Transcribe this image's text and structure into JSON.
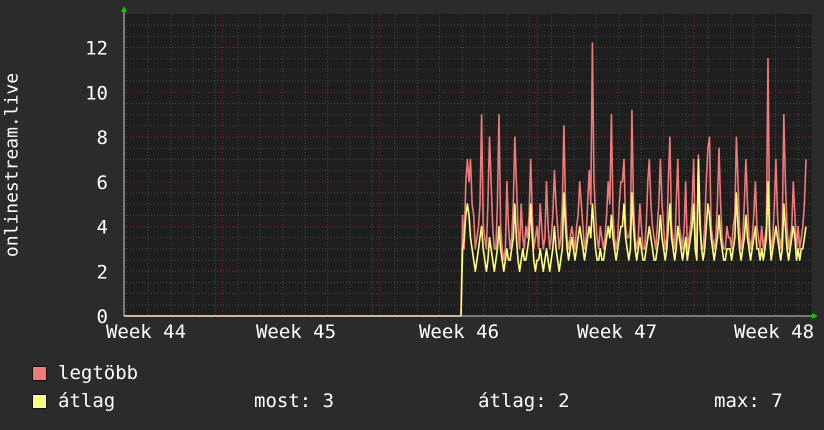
{
  "chart_data": {
    "type": "line",
    "ylabel": "onlinestream.live",
    "ylim": [
      0,
      13.5
    ],
    "yticks": [
      0,
      2,
      4,
      6,
      8,
      10,
      12
    ],
    "x_tick_labels": [
      "Week 44",
      "Week 45",
      "Week 46",
      "Week 47",
      "Week 48"
    ],
    "grid": true,
    "background": "#1e1e1e",
    "grid_color": "#a02020",
    "series": [
      {
        "name": "legtöbb",
        "color": "#f07b7b",
        "values": [
          0,
          0,
          0,
          0,
          0,
          0,
          0,
          0,
          0,
          0,
          0,
          0,
          0,
          0,
          0,
          0,
          0,
          0,
          0,
          0,
          0,
          0,
          0,
          0,
          0,
          0,
          0,
          0,
          0,
          0,
          0,
          0,
          0,
          0,
          0,
          0,
          0,
          0,
          0,
          0,
          0,
          0,
          0,
          0,
          0,
          0,
          0,
          0,
          0,
          0,
          0,
          0,
          0,
          0,
          0,
          0,
          0,
          0,
          0,
          0,
          0,
          0,
          0,
          0,
          0,
          0,
          0,
          0,
          0,
          0,
          0,
          0,
          0,
          0,
          0,
          0,
          0,
          0,
          0,
          0,
          0,
          0,
          0,
          0,
          0,
          0,
          0,
          0,
          0,
          0,
          0,
          0,
          0,
          0,
          0,
          0,
          0,
          0,
          0,
          0,
          0,
          0,
          0,
          0,
          0,
          0,
          0,
          0,
          0,
          0,
          0,
          0,
          0,
          0,
          0,
          0,
          0,
          0,
          0,
          0,
          0,
          0,
          0,
          0,
          0,
          0,
          0,
          0,
          0,
          0,
          0,
          0,
          0,
          0,
          0,
          0,
          0,
          0,
          0,
          0,
          0,
          0,
          0,
          0,
          0,
          0,
          0,
          0,
          0,
          0,
          0,
          0,
          0,
          0,
          0,
          0,
          0,
          0,
          0,
          0,
          0,
          0,
          0,
          0,
          0,
          0,
          0,
          0,
          0,
          0,
          0,
          0,
          0,
          0,
          0,
          0,
          0,
          0,
          0,
          0,
          0,
          0,
          0,
          0,
          0,
          0,
          0,
          0,
          0,
          0,
          0,
          0,
          0,
          0,
          0,
          0,
          0,
          0,
          0,
          0,
          0,
          0,
          0,
          0,
          0,
          0,
          0,
          0,
          0,
          0,
          0,
          0,
          0,
          0,
          4.5,
          3,
          6,
          7,
          6,
          7,
          5,
          4.5,
          3,
          3.5,
          4,
          5,
          9,
          4,
          3.5,
          3,
          5,
          8,
          6,
          4,
          3,
          3,
          5,
          9,
          4,
          3,
          2.5,
          3,
          6,
          4,
          3,
          3.5,
          5,
          8,
          6,
          4,
          3,
          5,
          3.5,
          3,
          4,
          3.5,
          4.5,
          7,
          4.5,
          3,
          3.5,
          4,
          3,
          5,
          4,
          3,
          3.5,
          6,
          4,
          3,
          3.5,
          4.5,
          6.5,
          5,
          4,
          3,
          3.5,
          5,
          8.5,
          5,
          3.5,
          3,
          3.5,
          4,
          3.5,
          3,
          4,
          4.5,
          6,
          5,
          4,
          3,
          3.5,
          5,
          6.5,
          5,
          12.2,
          6,
          4.5,
          3.5,
          3,
          4,
          3.5,
          3,
          3.5,
          4.5,
          6,
          5,
          9,
          4.5,
          3.5,
          3,
          3.5,
          5,
          6,
          6,
          7,
          4,
          3.5,
          3.5,
          4,
          9.2,
          5,
          3.5,
          3,
          3.5,
          5,
          4,
          3,
          3,
          4,
          6,
          7,
          5,
          4,
          3.5,
          3,
          4,
          5,
          7,
          5,
          4,
          3,
          3.5,
          6,
          8,
          4,
          3.5,
          3,
          5,
          7,
          4,
          3.5,
          3,
          4,
          6,
          3,
          3.5,
          4,
          5,
          7,
          3.5,
          3,
          7.2,
          4.5,
          3,
          3,
          4,
          6,
          7.5,
          8,
          4,
          3.5,
          3,
          3.5,
          5,
          7.5,
          5,
          3.5,
          3,
          3,
          4,
          3.5,
          3.5,
          3,
          4,
          4.5,
          8,
          6,
          4,
          3,
          3.5,
          5,
          7,
          5,
          3.5,
          3,
          3.5,
          4.5,
          6,
          4,
          3.5,
          3,
          4,
          3,
          3.5,
          4,
          11.5,
          4,
          3,
          3.5,
          5,
          7,
          4.5,
          3.5,
          3,
          4,
          9,
          6,
          4,
          3,
          3.5,
          4,
          6,
          4.5,
          3,
          4,
          3,
          3.5,
          4,
          5,
          7
        ]
      },
      {
        "name": "átlag",
        "color": "#ffff80",
        "values": [
          0,
          0,
          0,
          0,
          0,
          0,
          0,
          0,
          0,
          0,
          0,
          0,
          0,
          0,
          0,
          0,
          0,
          0,
          0,
          0,
          0,
          0,
          0,
          0,
          0,
          0,
          0,
          0,
          0,
          0,
          0,
          0,
          0,
          0,
          0,
          0,
          0,
          0,
          0,
          0,
          0,
          0,
          0,
          0,
          0,
          0,
          0,
          0,
          0,
          0,
          0,
          0,
          0,
          0,
          0,
          0,
          0,
          0,
          0,
          0,
          0,
          0,
          0,
          0,
          0,
          0,
          0,
          0,
          0,
          0,
          0,
          0,
          0,
          0,
          0,
          0,
          0,
          0,
          0,
          0,
          0,
          0,
          0,
          0,
          0,
          0,
          0,
          0,
          0,
          0,
          0,
          0,
          0,
          0,
          0,
          0,
          0,
          0,
          0,
          0,
          0,
          0,
          0,
          0,
          0,
          0,
          0,
          0,
          0,
          0,
          0,
          0,
          0,
          0,
          0,
          0,
          0,
          0,
          0,
          0,
          0,
          0,
          0,
          0,
          0,
          0,
          0,
          0,
          0,
          0,
          0,
          0,
          0,
          0,
          0,
          0,
          0,
          0,
          0,
          0,
          0,
          0,
          0,
          0,
          0,
          0,
          0,
          0,
          0,
          0,
          0,
          0,
          0,
          0,
          0,
          0,
          0,
          0,
          0,
          0,
          0,
          0,
          0,
          0,
          0,
          0,
          0,
          0,
          0,
          0,
          0,
          0,
          0,
          0,
          0,
          0,
          0,
          0,
          0,
          0,
          0,
          0,
          0,
          0,
          0,
          0,
          0,
          0,
          0,
          0,
          0,
          0,
          0,
          0,
          0,
          0,
          0,
          0,
          0,
          0,
          0,
          0,
          0,
          0,
          0,
          0,
          0,
          0,
          0,
          0,
          0,
          0,
          0,
          0,
          3,
          3.5,
          4.5,
          5,
          4.5,
          3.5,
          3,
          2.5,
          2,
          2.5,
          3,
          3.5,
          4,
          3,
          2.5,
          2,
          2.5,
          3.5,
          3,
          2.5,
          2,
          2.5,
          3,
          4,
          3,
          2.5,
          2,
          2.5,
          3,
          2.5,
          2.5,
          3,
          3.5,
          5,
          3.5,
          2.5,
          2,
          2.5,
          3,
          2.5,
          2.5,
          3,
          3.5,
          5,
          3.5,
          2.5,
          2,
          2.5,
          2.5,
          3,
          2.5,
          2,
          2.5,
          3,
          2.5,
          2,
          2.5,
          3,
          4,
          3,
          2.5,
          2,
          2.5,
          3,
          5.5,
          4,
          3,
          2.5,
          3,
          3.5,
          3,
          2.5,
          3,
          3.5,
          4,
          3.5,
          3,
          2.5,
          3,
          3.5,
          4,
          3.5,
          5,
          4,
          3,
          2.5,
          2.5,
          3,
          2.5,
          2.5,
          3,
          3.5,
          4,
          3.5,
          4.5,
          3.5,
          3,
          2.5,
          3,
          3.5,
          4,
          4,
          5,
          3.5,
          3,
          2.5,
          3,
          5.5,
          4,
          3,
          2.5,
          3,
          3.5,
          3,
          2.5,
          2.5,
          3,
          3.5,
          4,
          3.5,
          3,
          2.5,
          2.5,
          3,
          3.5,
          4.5,
          3.5,
          3,
          2.5,
          3,
          4,
          5,
          3.5,
          3,
          2.5,
          3,
          4,
          3.5,
          3,
          2.5,
          3,
          3.5,
          2.5,
          3,
          3.5,
          4,
          5,
          3,
          2.5,
          7,
          4,
          3,
          2.5,
          3,
          4,
          5,
          4.5,
          3.5,
          3,
          2.5,
          3,
          3.5,
          4.5,
          3.5,
          3,
          2.5,
          2.5,
          3,
          3,
          3,
          2.5,
          3,
          3.5,
          5.5,
          4,
          3,
          2.5,
          3,
          3.5,
          4.5,
          3.5,
          3,
          2.5,
          3,
          3.5,
          4,
          3,
          3,
          2.5,
          3,
          2.5,
          3,
          3.5,
          6,
          3.5,
          2.5,
          3,
          3.5,
          4,
          3.5,
          3,
          2.5,
          3,
          5,
          4,
          3,
          2.5,
          3,
          3.5,
          4,
          3.5,
          2.5,
          3,
          2.5,
          3,
          3,
          3.5,
          4
        ]
      }
    ]
  },
  "legend": {
    "items": [
      {
        "label": "legtöbb",
        "color": "#f07b7b"
      },
      {
        "label": "átlag",
        "color": "#ffff80"
      }
    ],
    "stats": {
      "most": "most: 3",
      "atlag": "átlag: 2",
      "max": "max: 7"
    }
  }
}
